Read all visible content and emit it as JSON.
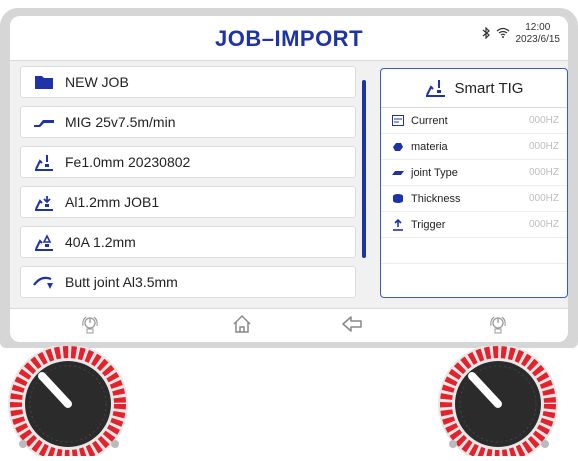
{
  "header": {
    "title": "JOB–IMPORT",
    "time": "12:00",
    "date": "2023/6/15",
    "icons": [
      "bluetooth-icon",
      "wifi-icon"
    ]
  },
  "jobs": [
    {
      "label": "NEW JOB",
      "icon": "folder-icon"
    },
    {
      "label": "MIG 25v7.5m/min",
      "icon": "mig-torch-icon"
    },
    {
      "label": "Fe1.0mm 20230802",
      "icon": "tig-process-icon"
    },
    {
      "label": "Al1.2mm JOB1",
      "icon": "tig-process-icon"
    },
    {
      "label": "40A 1.2mm",
      "icon": "tig-process-icon"
    },
    {
      "label": "Butt joint Al3.5mm",
      "icon": "butt-joint-icon"
    }
  ],
  "panel": {
    "title": "Smart TIG",
    "params": [
      {
        "name": "Current",
        "value": "000HZ"
      },
      {
        "name": "materia",
        "value": "000HZ"
      },
      {
        "name": "joint Type",
        "value": "000HZ"
      },
      {
        "name": "Thickness",
        "value": "000HZ"
      },
      {
        "name": "Trigger",
        "value": "000HZ"
      }
    ]
  },
  "colors": {
    "accent": "#1f33a8",
    "knob_red": "#e3222b"
  }
}
